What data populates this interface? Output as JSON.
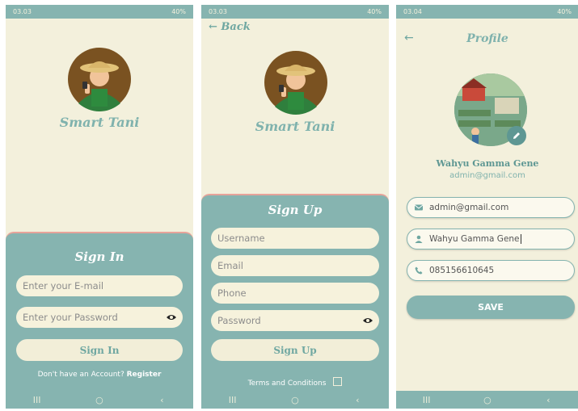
{
  "screen1": {
    "status": {
      "time": "03.03",
      "right": "40%"
    },
    "brand": "Smart Tani",
    "panel_title": "Sign In",
    "email_placeholder": "Enter your E-mail",
    "password_placeholder": "Enter your Password",
    "button_label": "Sign In",
    "footer_text": "Don't have an Account?",
    "footer_link": "Register"
  },
  "screen2": {
    "status": {
      "time": "03.03",
      "right": "40%"
    },
    "back_label": "← Back",
    "brand": "Smart Tani",
    "panel_title": "Sign Up",
    "username_placeholder": "Username",
    "email_placeholder": "Email",
    "phone_placeholder": "Phone",
    "password_placeholder": "Password",
    "button_label": "Sign Up",
    "terms_label": "Terms and Conditions"
  },
  "screen3": {
    "status": {
      "time": "03.04",
      "right": "40%"
    },
    "title": "Profile",
    "name": "Wahyu Gamma Gene",
    "email": "admin@gmail.com",
    "email_value": "admin@gmail.com",
    "name_value": "Wahyu Gamma Gene",
    "phone_value": "085156610645",
    "save_label": "SAVE"
  },
  "nav": {
    "recents": "III",
    "home": "○",
    "back": "‹"
  },
  "colors": {
    "teal": "#86b4b0",
    "cream": "#f3f0dc",
    "accent_border": "#e7a39a"
  }
}
